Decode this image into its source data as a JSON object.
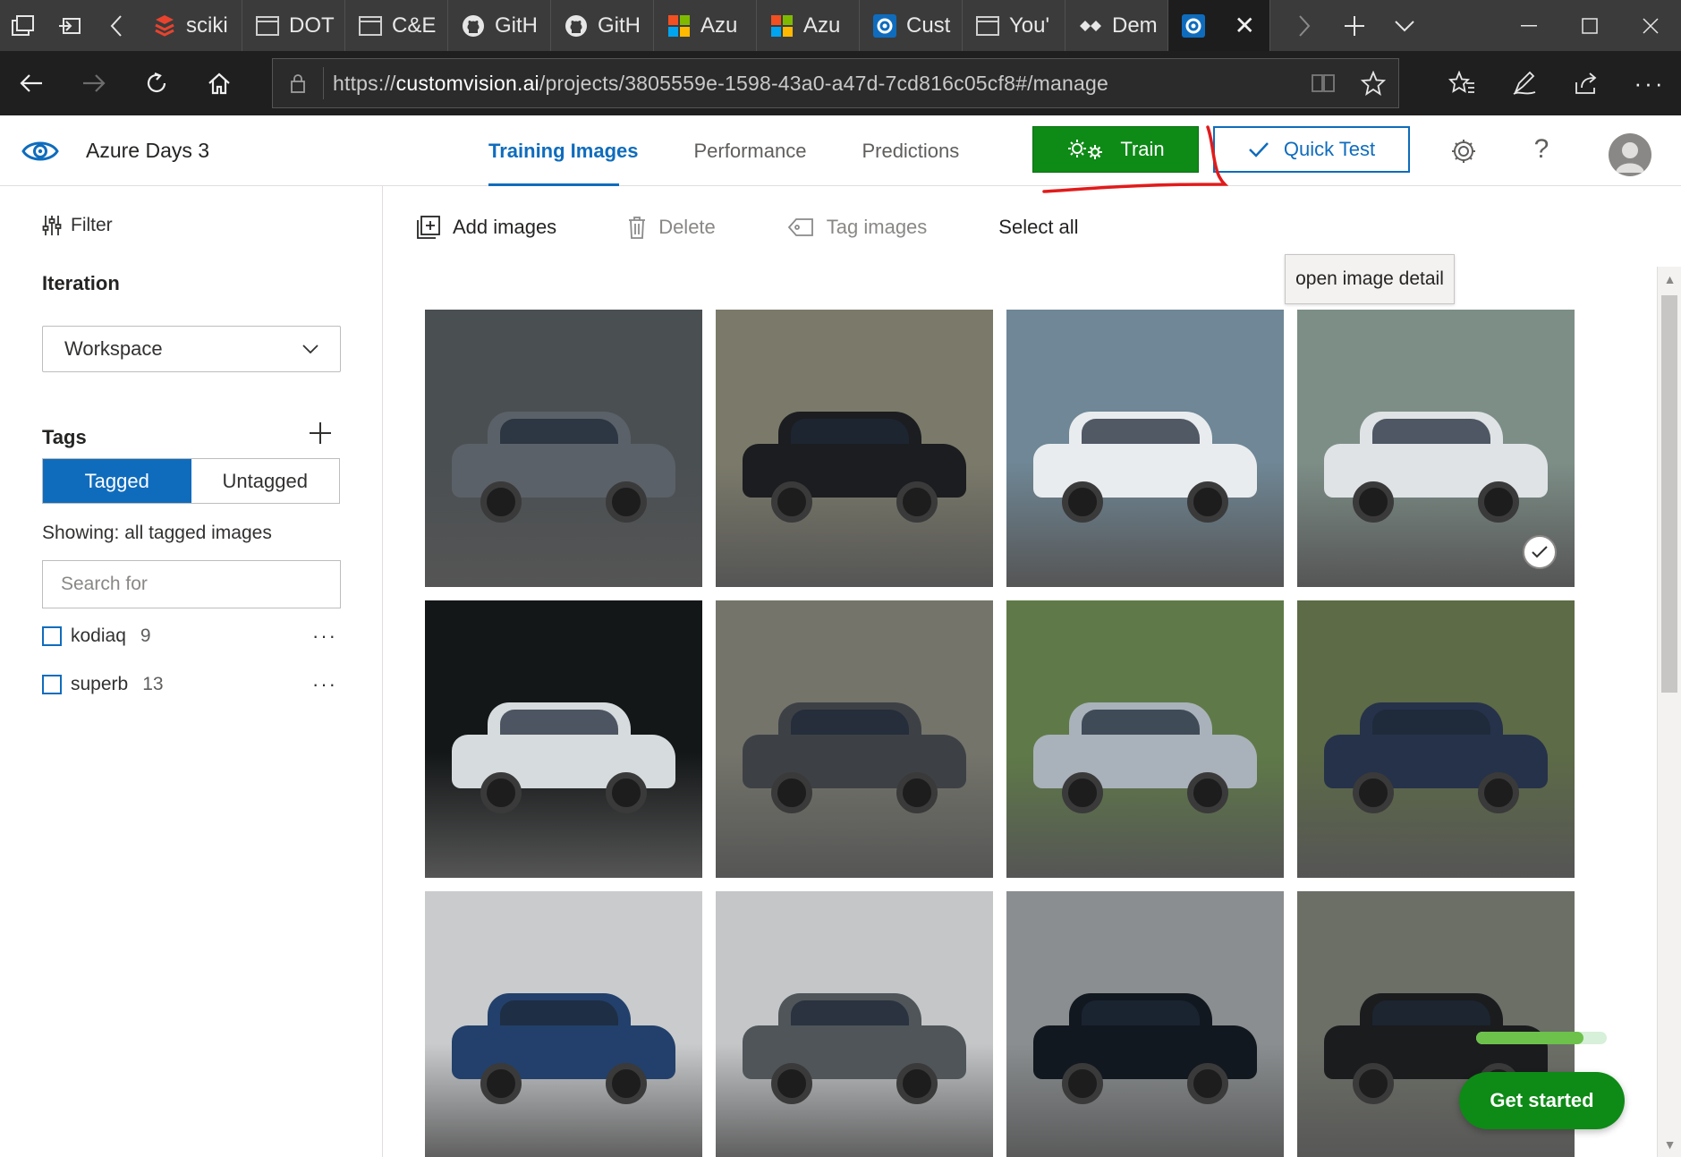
{
  "browser": {
    "tabs": [
      {
        "label": "sciki",
        "icon": "scikit-icon",
        "color": "#e8432e"
      },
      {
        "label": "DOT",
        "icon": "page-icon",
        "color": "#cfcfcf"
      },
      {
        "label": "C&E",
        "icon": "page-icon",
        "color": "#cfcfcf"
      },
      {
        "label": "GitH",
        "icon": "github-icon",
        "color": "#cfcfcf"
      },
      {
        "label": "GitH",
        "icon": "github-icon",
        "color": "#cfcfcf"
      },
      {
        "label": "Azu",
        "icon": "microsoft-icon",
        "color": "#f25022"
      },
      {
        "label": "Azu",
        "icon": "microsoft-icon",
        "color": "#f25022"
      },
      {
        "label": "Cust",
        "icon": "customvision-icon",
        "color": "#0f6cbd"
      },
      {
        "label": "You'",
        "icon": "page-icon",
        "color": "#cfcfcf"
      },
      {
        "label": "Dem",
        "icon": "dem-icon",
        "color": "#cfcfcf"
      }
    ],
    "url": {
      "scheme": "https://",
      "host": "customvision.ai",
      "path": "/projects/3805559e-1598-43a0-a47d-7cd816c05cf8#/manage"
    }
  },
  "app": {
    "title": "Azure Days 3",
    "tabs": [
      {
        "label": "Training Images",
        "active": true
      },
      {
        "label": "Performance",
        "active": false
      },
      {
        "label": "Predictions",
        "active": false
      }
    ],
    "train_label": "Train",
    "quick_test_label": "Quick Test",
    "help_label": "?"
  },
  "sidebar": {
    "filter_label": "Filter",
    "iteration_label": "Iteration",
    "iteration_value": "Workspace",
    "tags_label": "Tags",
    "tagged_label": "Tagged",
    "untagged_label": "Untagged",
    "showing_text": "Showing: all tagged images",
    "search_placeholder": "Search for",
    "tags": [
      {
        "name": "kodiaq",
        "count": "9"
      },
      {
        "name": "superb",
        "count": "13"
      }
    ]
  },
  "toolbar": {
    "add_images": "Add images",
    "delete": "Delete",
    "tag_images": "Tag images",
    "select_all": "Select all"
  },
  "tooltip": "open image detail",
  "images": [
    {
      "bg": "#4a4f52",
      "car": "#5b6168",
      "selected": false
    },
    {
      "bg": "#7b7a6a",
      "car": "#1c1d20",
      "selected": false
    },
    {
      "bg": "#6f8796",
      "car": "#e9ecef",
      "selected": false
    },
    {
      "bg": "#7d8e87",
      "car": "#dfe3e6",
      "selected": true
    },
    {
      "bg": "#141718",
      "car": "#d6dbdd",
      "selected": false
    },
    {
      "bg": "#74746b",
      "car": "#3d4145",
      "selected": false
    },
    {
      "bg": "#5f7a48",
      "car": "#a9b2ba",
      "selected": false
    },
    {
      "bg": "#5d6b47",
      "car": "#26324a",
      "selected": false
    },
    {
      "bg": "#c9cbcd",
      "car": "#22406b",
      "selected": false
    },
    {
      "bg": "#c4c6c8",
      "car": "#4f5559",
      "selected": false
    },
    {
      "bg": "#8a8e90",
      "car": "#121820",
      "selected": false
    },
    {
      "bg": "#6c6f66",
      "car": "#1b1c1e",
      "selected": false
    }
  ],
  "progress": 0.82,
  "get_started": "Get started",
  "colors": {
    "accent": "#0f6cbd",
    "train_green": "#0e8a16",
    "annotation_red": "#e21b1b"
  }
}
